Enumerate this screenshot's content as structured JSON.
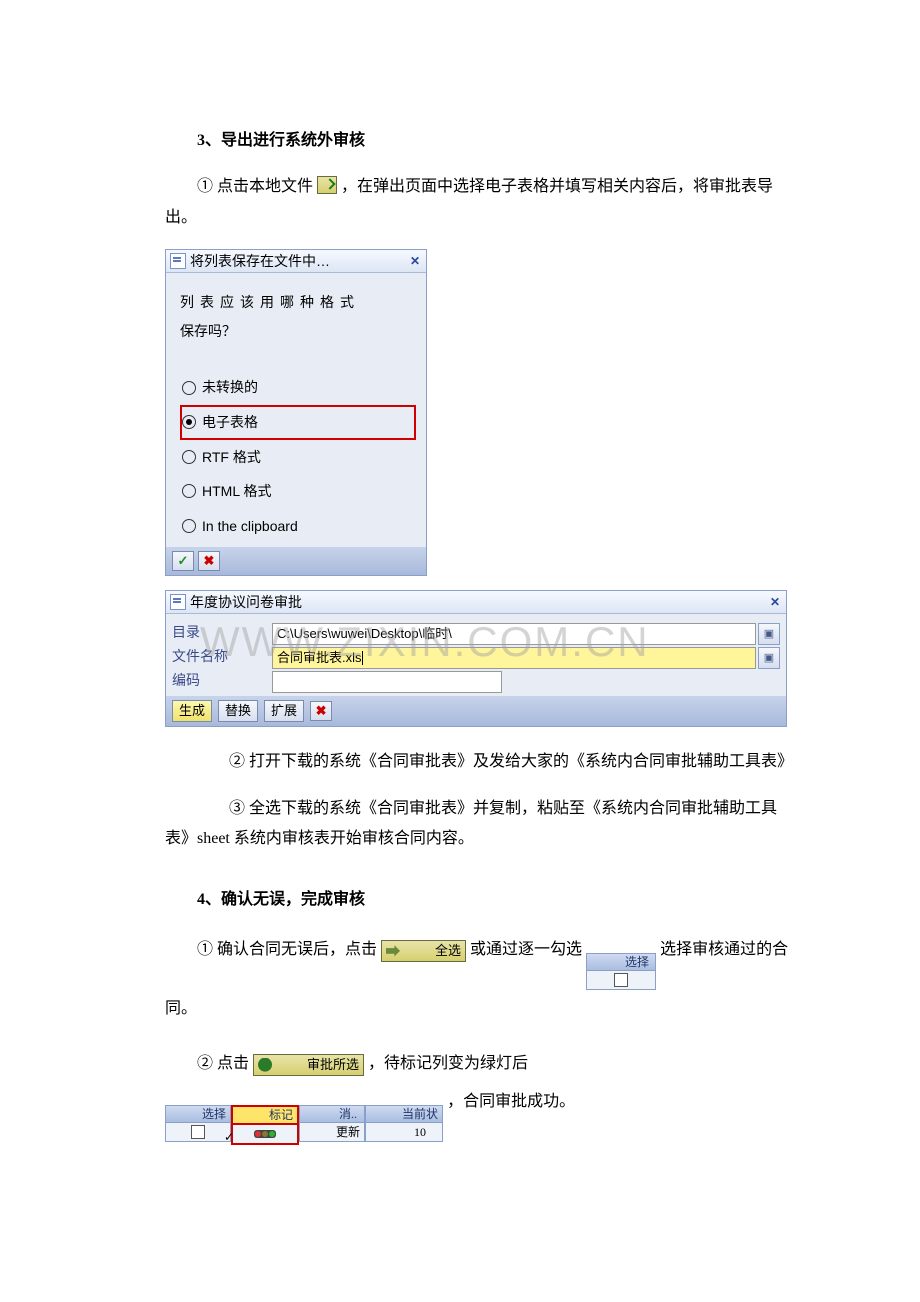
{
  "section3": {
    "heading": "3、导出进行系统外审核",
    "p1_prefix": "①  点击本地文件",
    "p1_suffix": "，在弹出页面中选择电子表格并填写相关内容后，将审批表导出。"
  },
  "dialog1": {
    "title": "将列表保存在文件中…",
    "prompt_l1": "列表应该用哪种格式",
    "prompt_l2": "保存吗？",
    "options": {
      "o1": "未转换的",
      "o2": "电子表格",
      "o3": "RTF 格式",
      "o4": "HTML 格式",
      "o5": "In the clipboard"
    },
    "ok": "✓",
    "cancel": "✖"
  },
  "dialog2": {
    "title": "年度协议问卷审批",
    "labels": {
      "dir": "目录",
      "filename": "文件名称",
      "encoding": "编码"
    },
    "values": {
      "dir": "C:\\Users\\wuwei\\Desktop\\临时\\",
      "filename": "合同审批表.xls",
      "encoding": ""
    },
    "buttons": {
      "generate": "生成",
      "replace": "替换",
      "extend": "扩展",
      "cancel": "✖"
    }
  },
  "watermark": "WWW.ZIXIN.COM.CN",
  "between": {
    "p2": "②  打开下载的系统《合同审批表》及发给大家的《系统内合同审批辅助工具表》",
    "p3": "③  全选下载的系统《合同审批表》并复制，粘贴至《系统内合同审批辅助工具表》sheet 系统内审核表开始审核合同内容。"
  },
  "section4": {
    "heading": "4、确认无误，完成审核",
    "p1_a": "①  确认合同无误后，点击",
    "selectall_label": "全选",
    "p1_b": "或通过逐一勾选",
    "select_hdr": "选择",
    "p1_c": "选择审核通过的合同。",
    "p2_a": "②  点击",
    "approve_label": "审批所选",
    "p2_b": "，待标记列变为绿灯后",
    "status_cols": {
      "select": "选择",
      "mark": "标记",
      "cancel": "消..",
      "current": "当前状",
      "update": "更新",
      "status_num": "10"
    },
    "p2_c": "，合同审批成功。"
  }
}
